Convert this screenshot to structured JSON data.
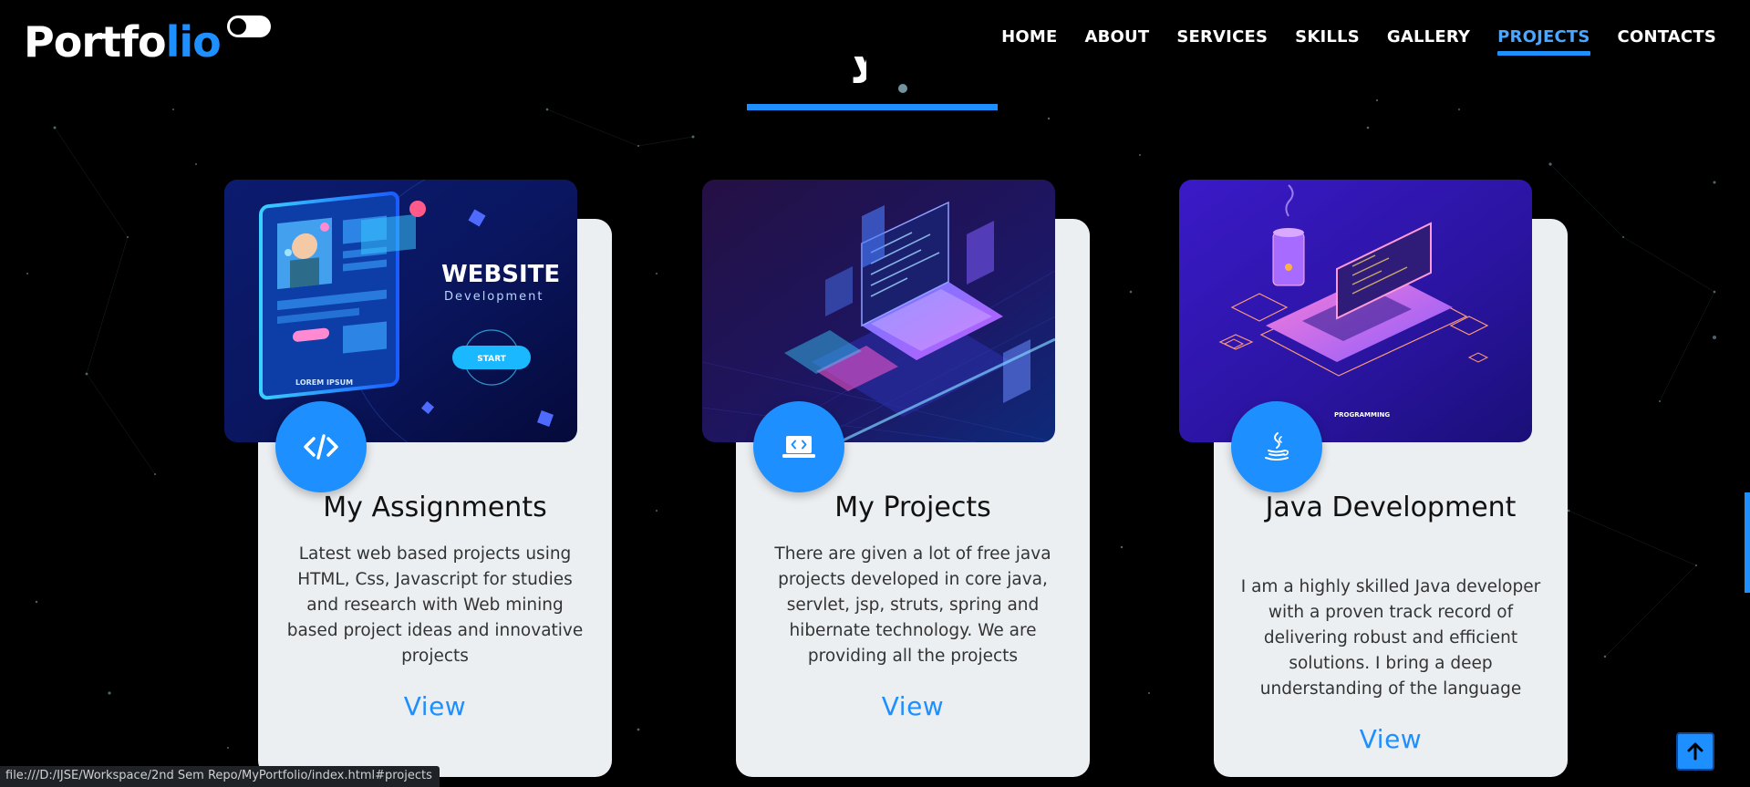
{
  "header": {
    "logo": {
      "main": "Portfo",
      "accent": "lio"
    },
    "theme_toggle": "toggle-switch",
    "nav": [
      "HOME",
      "ABOUT",
      "SERVICES",
      "SKILLS",
      "GALLERY",
      "PROJECTS",
      "CONTACTS"
    ],
    "active_nav": "PROJECTS"
  },
  "section": {
    "title_fragment": "y"
  },
  "cards": [
    {
      "image": {
        "heading": "WEBSITE",
        "subheading": "Development",
        "button": "START",
        "caption": "LOREM IPSUM"
      },
      "icon": "code-icon",
      "title": "My Assignments",
      "description": "Latest web based projects using HTML, Css, Javascript for studies and research with Web mining based project ideas and innovative projects",
      "link": "View"
    },
    {
      "image": {},
      "icon": "laptop-code-icon",
      "title": "My Projects",
      "description": "There are given a lot of free java projects developed in core java, servlet, jsp, struts, spring and hibernate technology. We are providing all the projects",
      "link": "View"
    },
    {
      "image": {
        "caption": "PROGRAMMING"
      },
      "icon": "java-icon",
      "title": "Java Development",
      "description": "I am a highly skilled Java developer with a proven track record of delivering robust and efficient solutions. I bring a deep understanding of the language",
      "link": "View"
    }
  ],
  "status_bar": {
    "url": "file:///D:/IJSE/Workspace/2nd Sem Repo/MyPortfolio/index.html#projects"
  },
  "back_to_top": "arrow-up-icon",
  "colors": {
    "accent": "#1e8fff",
    "background": "#000000",
    "card": "#eceff2"
  }
}
